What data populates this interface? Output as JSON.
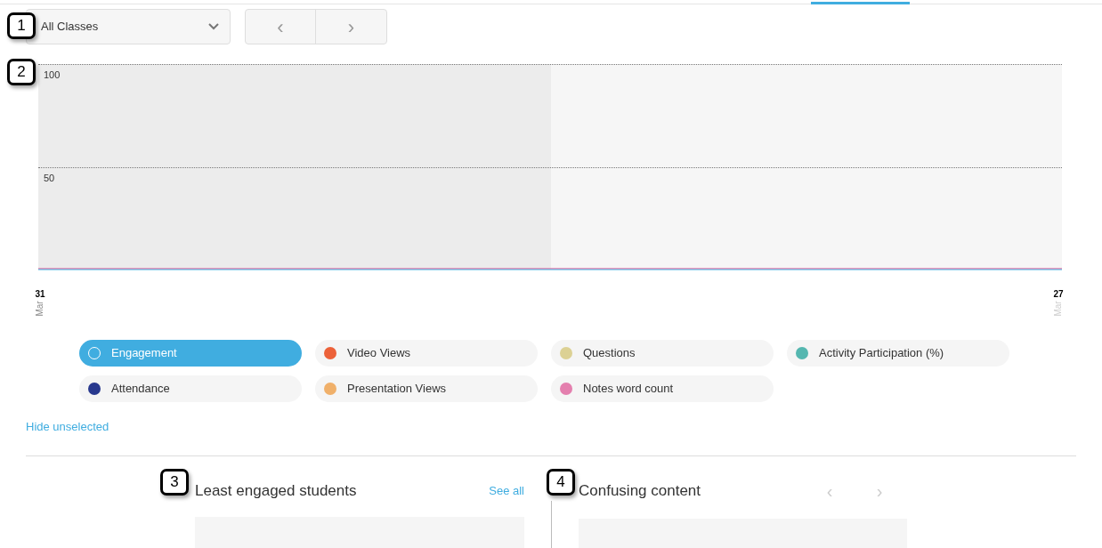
{
  "class_select": {
    "value": "All Classes"
  },
  "pager": {
    "prev": "‹",
    "next": "›"
  },
  "chart": {
    "y_labels": [
      "100",
      "50"
    ],
    "date_labels": [
      {
        "day": "31",
        "month": "Mar"
      },
      {
        "day": "27",
        "month": "Mar"
      }
    ]
  },
  "legend": [
    {
      "label": "Engagement",
      "color": "#40ade0",
      "selected": true
    },
    {
      "label": "Video Views",
      "color": "#ec6139",
      "selected": false
    },
    {
      "label": "Questions",
      "color": "#dcd194",
      "selected": false
    },
    {
      "label": "Activity Participation (%)",
      "color": "#55b7b0",
      "selected": false
    },
    {
      "label": "Attendance",
      "color": "#28398e",
      "selected": false
    },
    {
      "label": "Presentation Views",
      "color": "#f0b06a",
      "selected": false
    },
    {
      "label": "Notes word count",
      "color": "#e47fae",
      "selected": false
    }
  ],
  "hide_unselected": "Hide unselected",
  "least_engaged": {
    "title": "Least engaged students",
    "link": "See all"
  },
  "confusing": {
    "title": "Confusing content",
    "prev": "‹",
    "next": "›"
  },
  "callouts": [
    "1",
    "2",
    "3",
    "4"
  ]
}
